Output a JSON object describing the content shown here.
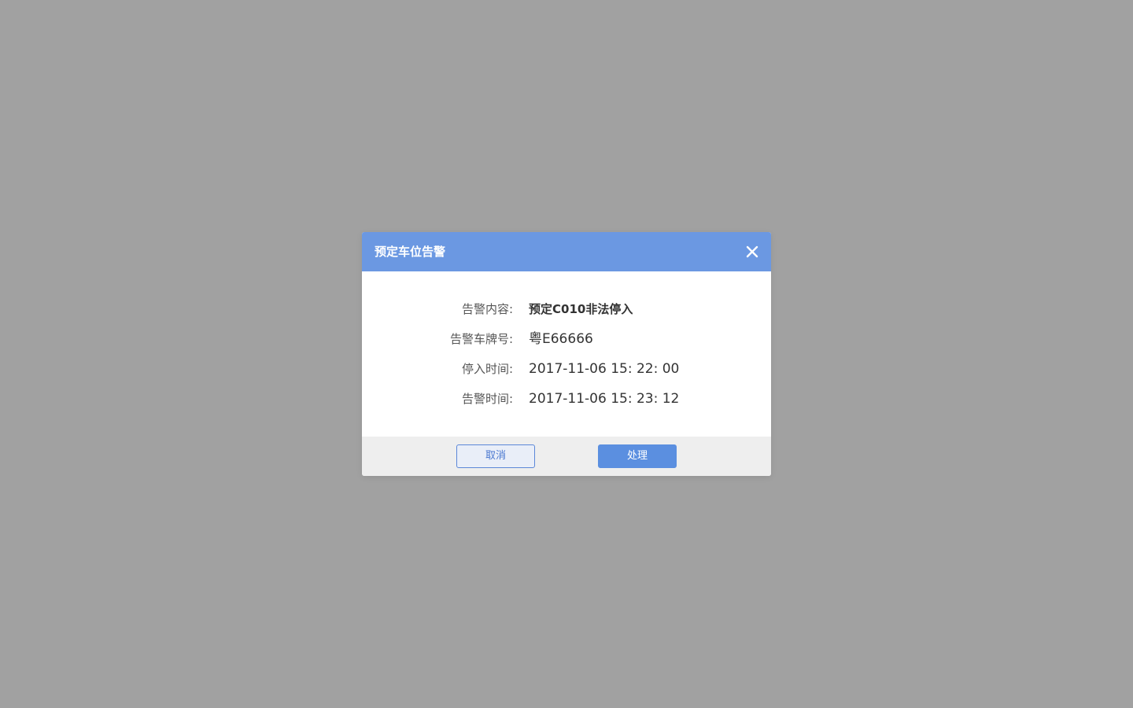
{
  "dialog": {
    "title": "预定车位告警",
    "close_icon": "close-icon",
    "header_color": "#6b98e2",
    "fields": [
      {
        "label": "告警内容:",
        "value": "预定C010非法停入"
      },
      {
        "label": "告警车牌号:",
        "value": "粤E66666"
      },
      {
        "label": "停入时间:",
        "value": "2017-11-06 15: 22: 00"
      },
      {
        "label": "告警时间:",
        "value": "2017-11-06 15: 23: 12"
      }
    ],
    "cancel_label": "取消",
    "process_label": "处理",
    "accent_color": "#5b8fe0"
  }
}
